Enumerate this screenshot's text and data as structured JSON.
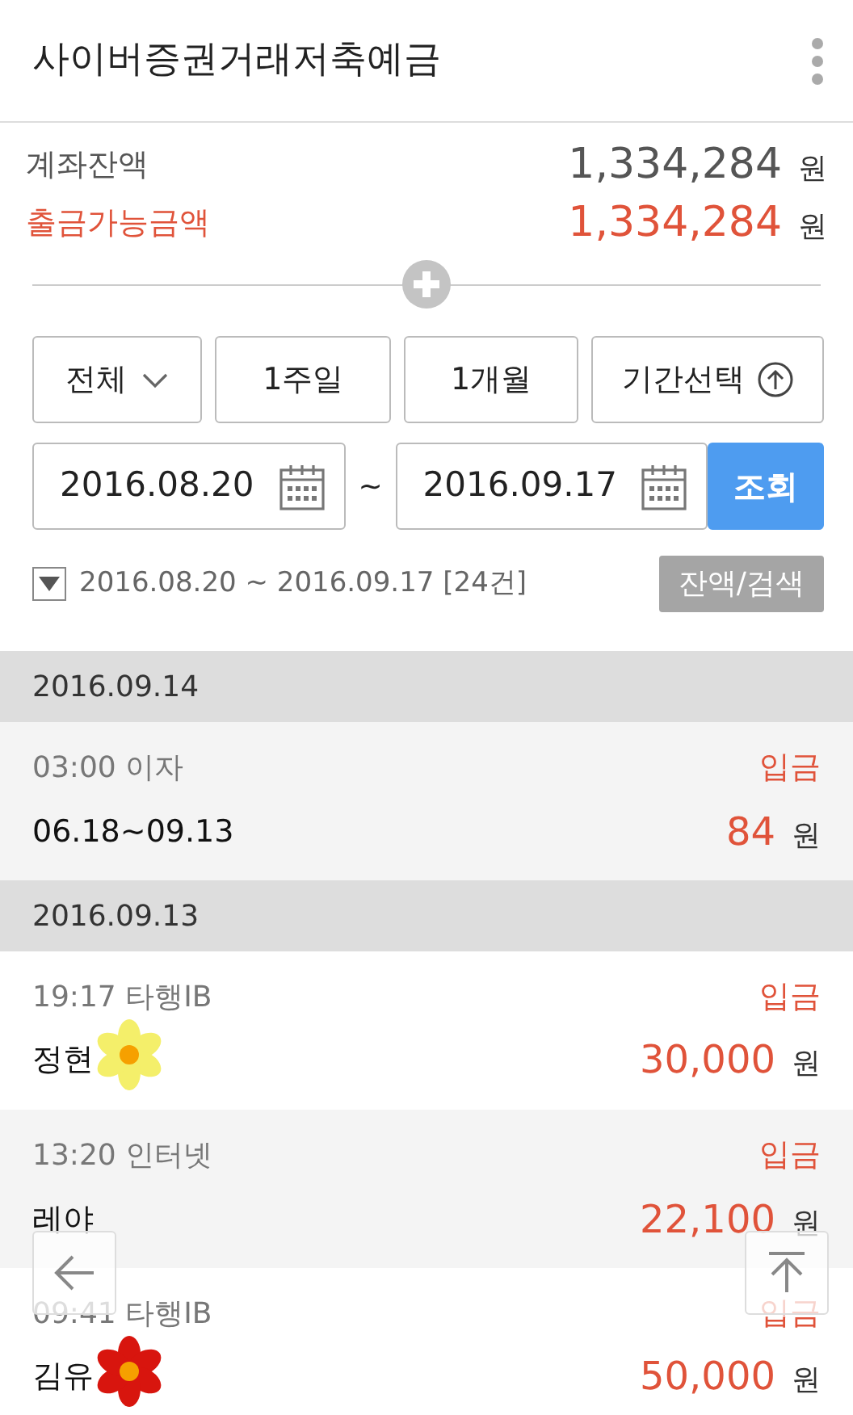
{
  "header": {
    "title": "사이버증권거래저축예금"
  },
  "balances": [
    {
      "kind": "total",
      "label": "계좌잔액",
      "amount": "1,334,284",
      "unit": "원"
    },
    {
      "kind": "available",
      "label": "출금가능금액",
      "amount": "1,334,284",
      "unit": "원"
    }
  ],
  "period_buttons": [
    {
      "kind": "dropdown",
      "label": "전체"
    },
    {
      "kind": "plain",
      "label": "1주일"
    },
    {
      "kind": "plain",
      "label": "1개월"
    },
    {
      "kind": "toggle",
      "label": "기간선택"
    }
  ],
  "date_range": {
    "start": "2016.08.20",
    "separator": "~",
    "end": "2016.09.17",
    "search_button": "조회"
  },
  "summary": {
    "text": "2016.08.20 ~ 2016.09.17 [24건]",
    "balance_search_button": "잔액/검색"
  },
  "days": [
    {
      "date": "2016.09.14",
      "transactions": [
        {
          "time": "03:00",
          "channel": "이자",
          "type": "입금",
          "memo": "06.18~09.13",
          "amount": "84",
          "unit": "원"
        }
      ]
    },
    {
      "date": "2016.09.13",
      "transactions": [
        {
          "time": "19:17",
          "channel": "타행IB",
          "type": "입금",
          "memo": "정현",
          "amount": "30,000",
          "unit": "원",
          "sticker": {
            "color": "#f4ef6a"
          }
        },
        {
          "time": "13:20",
          "channel": "인터넷",
          "type": "입금",
          "memo": "레야",
          "amount": "22,100",
          "unit": "원"
        },
        {
          "time": "09:41",
          "channel": "타행IB",
          "type": "입금",
          "memo": "김유",
          "amount": "50,000",
          "unit": "원",
          "sticker": {
            "color": "#d8150e"
          }
        }
      ]
    }
  ]
}
